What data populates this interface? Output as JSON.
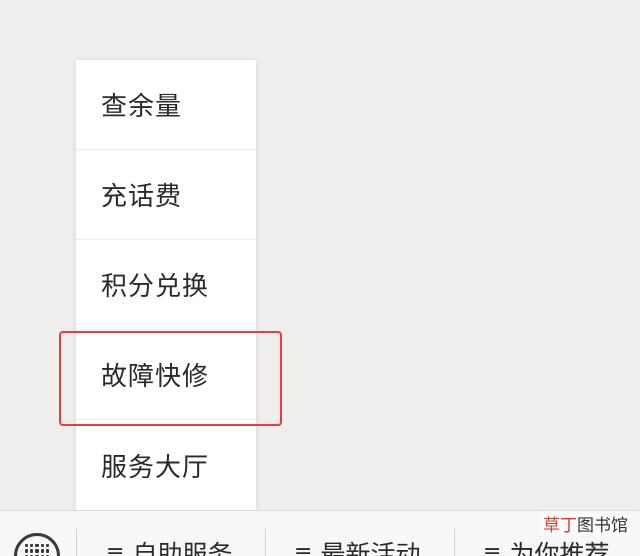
{
  "popup_menu": {
    "items": [
      {
        "label": "查余量"
      },
      {
        "label": "充话费"
      },
      {
        "label": "积分兑换"
      },
      {
        "label": "故障快修"
      },
      {
        "label": "服务大厅"
      }
    ]
  },
  "bottom_bar": {
    "tabs": [
      {
        "label": "自助服务",
        "icon": "menu-lines-icon"
      },
      {
        "label": "最新活动",
        "icon": "menu-lines-icon"
      },
      {
        "label": "为你推荐",
        "icon": "menu-lines-icon"
      }
    ]
  },
  "watermark": {
    "accent_text": "草丁",
    "text": "图书馆"
  },
  "colors": {
    "highlight": "#e2403d",
    "watermark_accent": "#d9402b"
  }
}
